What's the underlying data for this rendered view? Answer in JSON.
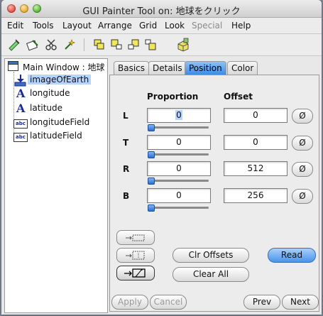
{
  "window": {
    "title": "GUI Painter Tool on: 地球をクリック"
  },
  "menubar": {
    "items": [
      {
        "label": "Edit",
        "enabled": true
      },
      {
        "label": "Tools",
        "enabled": true
      },
      {
        "label": "Layout",
        "enabled": true
      },
      {
        "label": "Arrange",
        "enabled": true
      },
      {
        "label": "Grid",
        "enabled": true
      },
      {
        "label": "Look",
        "enabled": true
      },
      {
        "label": "Special",
        "enabled": false
      },
      {
        "label": "Help",
        "enabled": true
      }
    ]
  },
  "toolbar": {
    "tools": [
      "paste-tool-icon",
      "install-tool-icon",
      "cut-tool-icon",
      "define-tool-icon",
      "align-left-icon",
      "align-top-icon",
      "align-right-icon",
      "align-bottom-icon",
      "group-icon"
    ]
  },
  "tree": {
    "root": "Main Window : 地球",
    "items": [
      {
        "label": "imageOfEarth",
        "icon": "image-icon",
        "selected": true
      },
      {
        "label": "longitude",
        "icon": "label-icon"
      },
      {
        "label": "latitude",
        "icon": "label-icon"
      },
      {
        "label": "longitudeField",
        "icon": "input-field-icon"
      },
      {
        "label": "latitudeField",
        "icon": "input-field-icon"
      }
    ],
    "label_icon_glyph": "A",
    "field_icon_text": "abc"
  },
  "tabs": [
    "Basics",
    "Details",
    "Position",
    "Color"
  ],
  "active_tab": "Position",
  "position": {
    "proportion_header": "Proportion",
    "offset_header": "Offset",
    "reset_glyph": "Ø",
    "rows": [
      {
        "label": "L",
        "proportion": "0",
        "offset": "0",
        "slider": 0
      },
      {
        "label": "T",
        "proportion": "0",
        "offset": "0",
        "slider": 0
      },
      {
        "label": "R",
        "proportion": "0",
        "offset": "512",
        "slider": 0
      },
      {
        "label": "B",
        "proportion": "0",
        "offset": "256",
        "slider": 0
      }
    ]
  },
  "actions": {
    "clear_offsets": "Clr Offsets",
    "read": "Read",
    "clear_all": "Clear All"
  },
  "footer": {
    "apply": "Apply",
    "cancel": "Cancel",
    "prev": "Prev",
    "next": "Next"
  },
  "colors": {
    "accent": "#3e8be8",
    "selection": "#b5d5ff"
  }
}
